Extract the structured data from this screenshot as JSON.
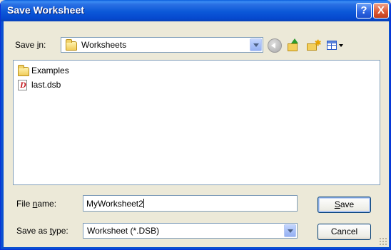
{
  "window": {
    "title": "Save Worksheet",
    "help_glyph": "?",
    "close_glyph": "X"
  },
  "save_in": {
    "label_pre": "Save ",
    "label_access": "i",
    "label_post": "n:",
    "value": "Worksheets"
  },
  "toolbar": {
    "icons": [
      "back-icon",
      "up-folder-icon",
      "new-folder-icon",
      "views-menu-icon"
    ]
  },
  "files": [
    {
      "name": "Examples",
      "icon": "folder-icon"
    },
    {
      "name": "last.dsb",
      "icon": "dsb-file-icon"
    }
  ],
  "file_name": {
    "label_pre": "File ",
    "label_access": "n",
    "label_post": "ame:",
    "value": "MyWorksheet2"
  },
  "save_type": {
    "label_pre": "Save as ",
    "label_access": "t",
    "label_post": "ype:",
    "value": "Worksheet (*.DSB)"
  },
  "buttons": {
    "save_access": "S",
    "save_rest": "ave",
    "cancel": "Cancel"
  },
  "colors": {
    "titlebar": "#0b58d8",
    "dialog_bg": "#ece9d8",
    "field_border": "#7f9db9"
  }
}
